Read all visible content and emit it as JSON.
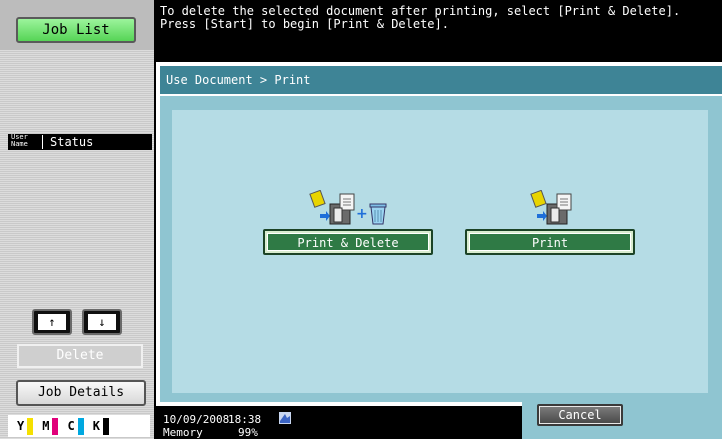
{
  "sidebar": {
    "job_list_label": "Job List",
    "column_user": "User Name",
    "column_user_line1": "User",
    "column_user_line2": "Name",
    "column_status": "Status",
    "up_label": "↑",
    "down_label": "↓",
    "delete_label": "Delete",
    "job_details_label": "Job Details",
    "toner": [
      {
        "label": "Y",
        "color": "#f5e000"
      },
      {
        "label": "M",
        "color": "#e0007a"
      },
      {
        "label": "C",
        "color": "#00a8e0"
      },
      {
        "label": "K",
        "color": "#000000"
      }
    ]
  },
  "message": {
    "line1": "To delete the selected document after printing, select [Print & Delete].",
    "line2": "Press [Start] to begin [Print & Delete]."
  },
  "main": {
    "breadcrumb": "Use Document > Print",
    "print_delete_label": "Print & Delete",
    "print_label": "Print"
  },
  "status_bar": {
    "date": "10/09/2008",
    "time": "18:38",
    "memory_label": "Memory",
    "memory_value": "99%",
    "cancel_label": "Cancel"
  },
  "colors": {
    "title_bar": "#3e8496",
    "content_bg": "#8fc5d1",
    "button_green": "#2f7a45",
    "job_list_green": "#56d456"
  }
}
